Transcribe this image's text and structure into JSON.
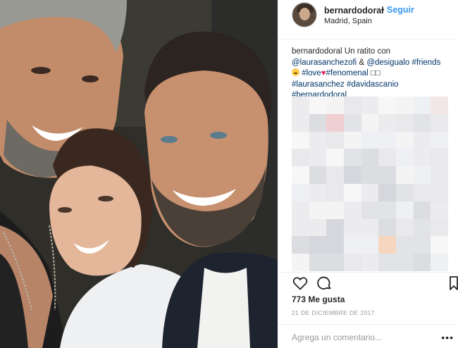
{
  "post": {
    "username": "bernardodoral",
    "separator": "•",
    "follow_label": "Seguir",
    "location": "Madrid, Spain",
    "caption": {
      "user": "bernardodoral",
      "text": "Un ratito con",
      "mention1": "@laurasanchezofi",
      "amp": "&",
      "mention2": "@desigualo",
      "tag_friends": "#friends",
      "tag_love": "#love",
      "tag_fenomenal": "#fenomenal",
      "trailing": "□□",
      "tag_laurasanchez": "#laurasanchez",
      "tag_davidascanio": "#davidascanio",
      "tag_bernardodoral": "#bernardodoral"
    },
    "likes_count": "773",
    "likes_label": "Me gusta",
    "date": "21 DE DICIEMBRE DE 2017",
    "comment_placeholder": "Agrega un comentario...",
    "more_label": "•••"
  },
  "icons": {
    "like": "heart-outline-icon",
    "comment": "speech-bubble-icon",
    "save": "bookmark-icon",
    "avatar": "profile-avatar"
  },
  "colors": {
    "link": "#003569",
    "follow": "#3897f0",
    "heart": "#e0245e",
    "text": "#262626",
    "muted": "#999999"
  }
}
